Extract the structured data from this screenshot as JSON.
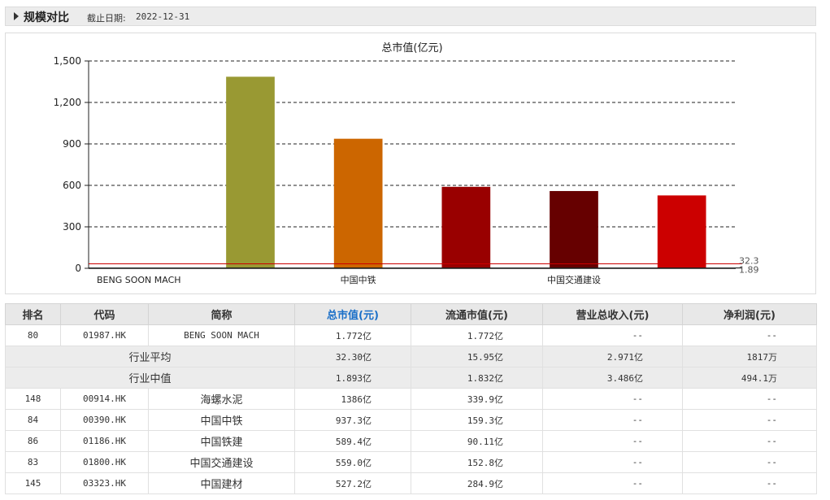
{
  "header": {
    "title": "规模对比",
    "date_label": "截止日期:",
    "date_value": "2022-12-31"
  },
  "chart_data": {
    "type": "bar",
    "title": "总市值(亿元)",
    "categories": [
      "BENG SOON MACH",
      "海螺水泥",
      "中国中铁",
      "中国铁建",
      "中国交通建设",
      "中国建材"
    ],
    "x_labels_shown": [
      "BENG SOON MACH",
      "中国中铁",
      "中国交通建设"
    ],
    "values": [
      1.772,
      1386,
      937.3,
      589.4,
      559.0,
      527.2
    ],
    "colors": [
      "#999933",
      "#999933",
      "#cc6600",
      "#990000",
      "#660000",
      "#cc0000"
    ],
    "ylim": [
      0,
      1500
    ],
    "yticks": [
      0,
      300,
      600,
      900,
      1200,
      1500
    ],
    "ytick_labels": [
      "0",
      "300",
      "600",
      "900",
      "1,200",
      "1,500"
    ],
    "grid": true,
    "reference_lines": [
      {
        "label": "32.3",
        "value": 32.3,
        "color": "#cc0000"
      },
      {
        "label": "1.89",
        "value": 1.89,
        "color": "#000000"
      }
    ]
  },
  "table": {
    "headers": [
      "排名",
      "代码",
      "简称",
      "总市值(元)",
      "流通市值(元)",
      "营业总收入(元)",
      "净利润(元)"
    ],
    "active_header": 3,
    "self_row": {
      "rank": "80",
      "code": "01987.HK",
      "name": "BENG SOON MACH",
      "mcap": "1.772亿",
      "float": "1.772亿",
      "revenue": "--",
      "profit": "--"
    },
    "avg_row": {
      "label": "行业平均",
      "mcap": "32.30亿",
      "float": "15.95亿",
      "revenue": "2.971亿",
      "profit": "1817万"
    },
    "median_row": {
      "label": "行业中值",
      "mcap": "1.893亿",
      "float": "1.832亿",
      "revenue": "3.486亿",
      "profit": "494.1万"
    },
    "peers": [
      {
        "rank": "148",
        "code": "00914.HK",
        "name": "海螺水泥",
        "mcap": "1386亿",
        "float": "339.9亿",
        "revenue": "--",
        "profit": "--"
      },
      {
        "rank": "84",
        "code": "00390.HK",
        "name": "中国中铁",
        "mcap": "937.3亿",
        "float": "159.3亿",
        "revenue": "--",
        "profit": "--"
      },
      {
        "rank": "86",
        "code": "01186.HK",
        "name": "中国铁建",
        "mcap": "589.4亿",
        "float": "90.11亿",
        "revenue": "--",
        "profit": "--"
      },
      {
        "rank": "83",
        "code": "01800.HK",
        "name": "中国交通建设",
        "mcap": "559.0亿",
        "float": "152.8亿",
        "revenue": "--",
        "profit": "--"
      },
      {
        "rank": "145",
        "code": "03323.HK",
        "name": "中国建材",
        "mcap": "527.2亿",
        "float": "284.9亿",
        "revenue": "--",
        "profit": "--"
      }
    ]
  }
}
